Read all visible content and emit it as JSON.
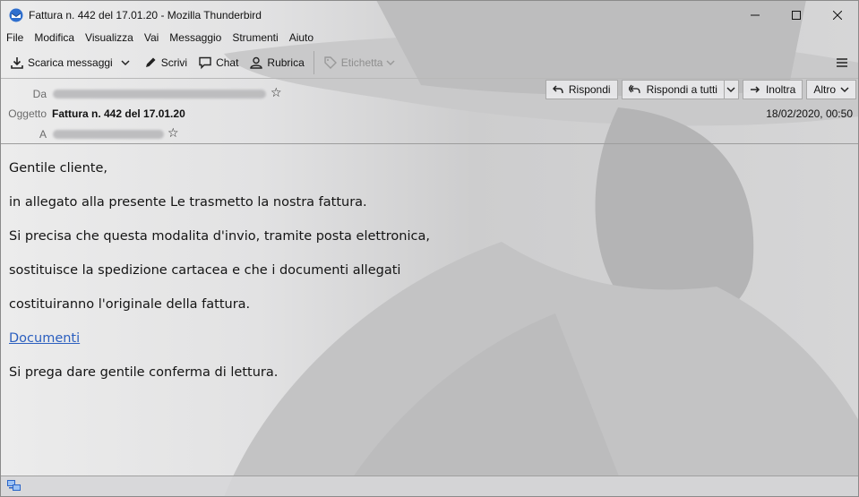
{
  "window": {
    "title": "Fattura n. 442 del 17.01.20 - Mozilla Thunderbird"
  },
  "menu": [
    "File",
    "Modifica",
    "Visualizza",
    "Vai",
    "Messaggio",
    "Strumenti",
    "Aiuto"
  ],
  "toolbar": {
    "get_messages": "Scarica messaggi",
    "write": "Scrivi",
    "chat": "Chat",
    "address_book": "Rubrica",
    "tag": "Etichetta"
  },
  "header": {
    "from_label": "Da",
    "subject_label": "Oggetto",
    "to_label": "A",
    "subject": "Fattura n. 442 del 17.01.20",
    "date": "18/02/2020, 00:50",
    "actions": {
      "reply": "Rispondi",
      "reply_all": "Rispondi a tutti",
      "forward": "Inoltra",
      "other": "Altro"
    }
  },
  "body": {
    "greeting": "Gentile cliente,",
    "line1": "in allegato alla presente Le trasmetto la nostra fattura.",
    "line2": "Si precisa che questa modalita d'invio, tramite posta elettronica,",
    "line3": "sostituisce la spedizione cartacea e che i documenti allegati",
    "line4": "costituiranno l'originale della fattura.",
    "link": "Documenti",
    "closing": "Si prega dare gentile conferma di lettura."
  },
  "colors": {
    "link": "#2b5fbf",
    "accent": "#4a7bd0"
  }
}
